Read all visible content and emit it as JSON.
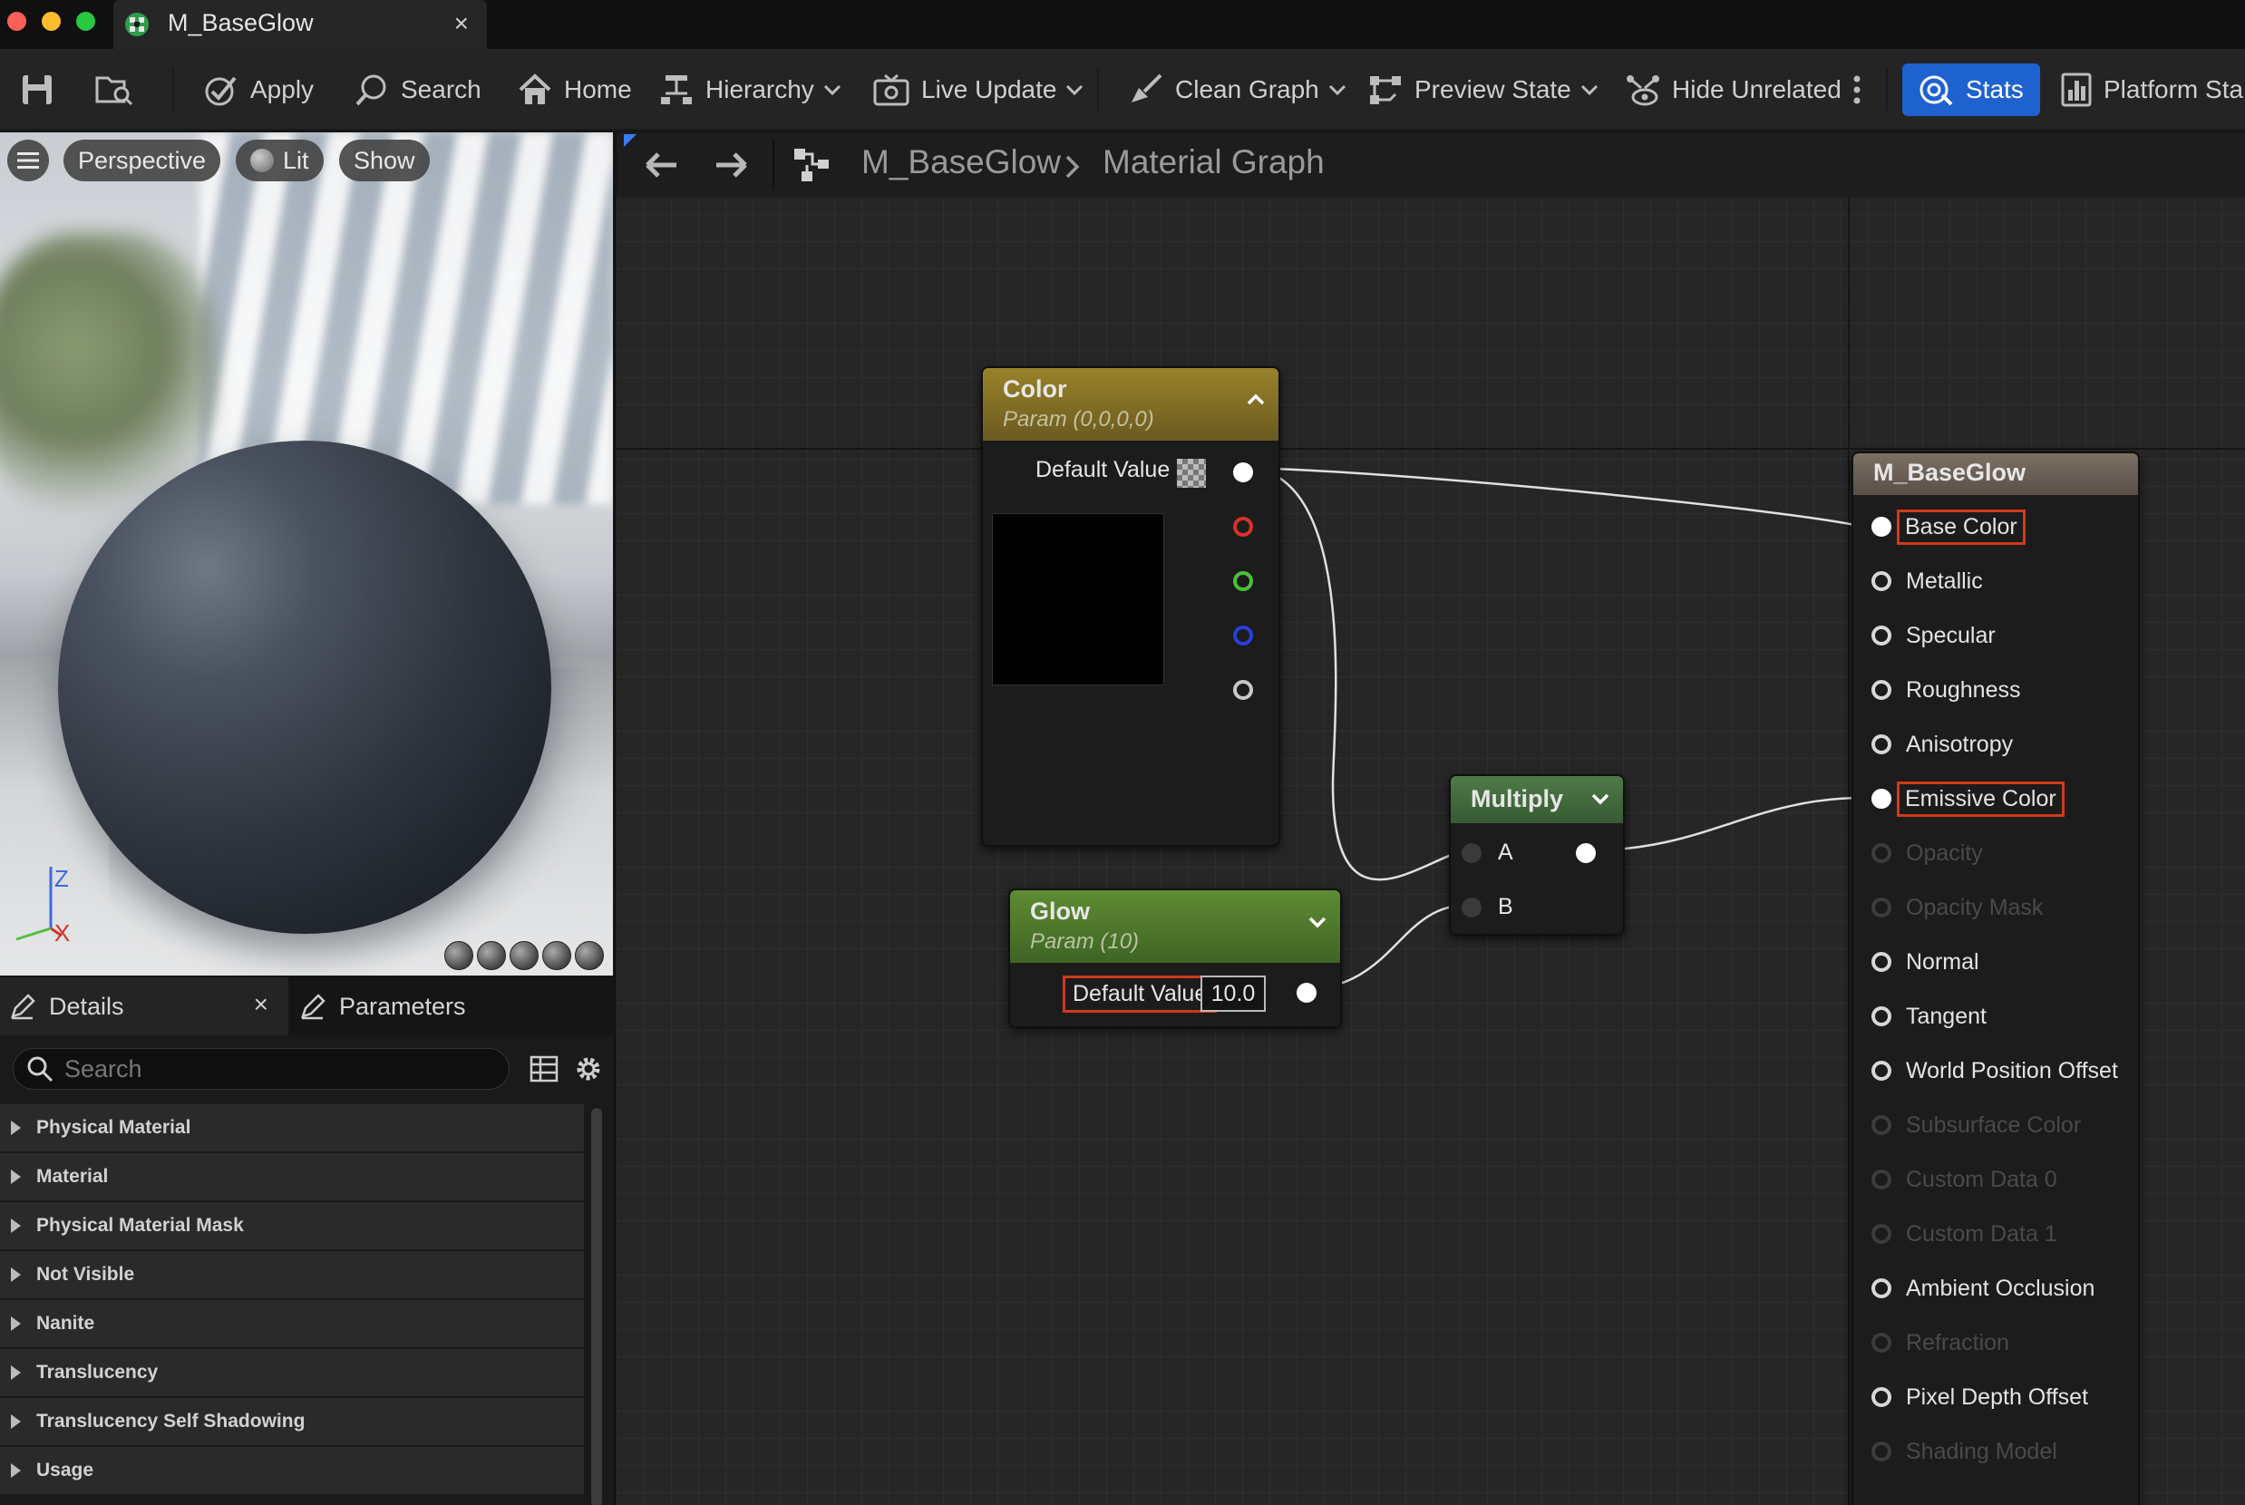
{
  "window": {
    "tab_title": "M_BaseGlow",
    "tab_close": "×"
  },
  "toolbar": {
    "apply": "Apply",
    "search": "Search",
    "home": "Home",
    "hierarchy": "Hierarchy",
    "live_update": "Live Update",
    "clean_graph": "Clean Graph",
    "preview_state": "Preview State",
    "hide_unrelated": "Hide Unrelated",
    "stats": "Stats",
    "platform_stats": "Platform Sta"
  },
  "viewport": {
    "perspective": "Perspective",
    "lit": "Lit",
    "show": "Show",
    "axis_z": "Z",
    "axis_x": "X"
  },
  "details": {
    "tab_details": "Details",
    "tab_close": "×",
    "tab_parameters": "Parameters",
    "search_placeholder": "Search",
    "categories": [
      "Physical Material",
      "Material",
      "Physical Material Mask",
      "Not Visible",
      "Nanite",
      "Translucency",
      "Translucency Self Shadowing",
      "Usage"
    ]
  },
  "graph": {
    "breadcrumb_material": "M_BaseGlow",
    "breadcrumb_graph": "Material Graph",
    "color_node": {
      "title": "Color",
      "subtitle": "Param (0,0,0,0)",
      "default_value_label": "Default Value",
      "header_color": "#8a7424"
    },
    "glow_node": {
      "title": "Glow",
      "subtitle": "Param (10)",
      "default_value_label": "Default Value",
      "default_value": "10.0",
      "header_color": "#4f7a2c"
    },
    "multiply_node": {
      "title": "Multiply",
      "input_a": "A",
      "input_b": "B",
      "header_color": "#3f6a3a"
    },
    "result_node": {
      "title": "M_BaseGlow",
      "inputs": [
        {
          "label": "Base Color",
          "state": "connected",
          "highlight": true
        },
        {
          "label": "Metallic",
          "state": "enabled"
        },
        {
          "label": "Specular",
          "state": "enabled"
        },
        {
          "label": "Roughness",
          "state": "enabled"
        },
        {
          "label": "Anisotropy",
          "state": "enabled"
        },
        {
          "label": "Emissive Color",
          "state": "connected",
          "highlight": true
        },
        {
          "label": "Opacity",
          "state": "disabled"
        },
        {
          "label": "Opacity Mask",
          "state": "disabled"
        },
        {
          "label": "Normal",
          "state": "enabled"
        },
        {
          "label": "Tangent",
          "state": "enabled"
        },
        {
          "label": "World Position Offset",
          "state": "enabled"
        },
        {
          "label": "Subsurface Color",
          "state": "disabled"
        },
        {
          "label": "Custom Data 0",
          "state": "disabled"
        },
        {
          "label": "Custom Data 1",
          "state": "disabled"
        },
        {
          "label": "Ambient Occlusion",
          "state": "enabled"
        },
        {
          "label": "Refraction",
          "state": "disabled"
        },
        {
          "label": "Pixel Depth Offset",
          "state": "enabled"
        },
        {
          "label": "Shading Model",
          "state": "disabled"
        }
      ]
    }
  },
  "colors": {
    "accent_blue": "#1e62d0",
    "highlight_red": "#d03a1a"
  }
}
